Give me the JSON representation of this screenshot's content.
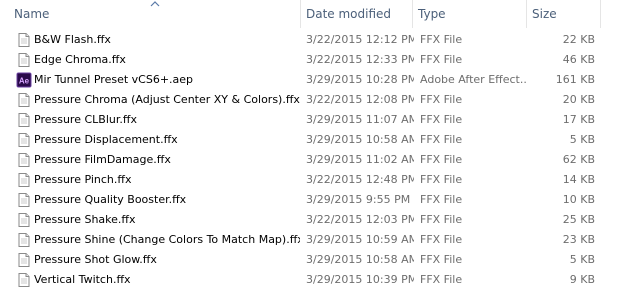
{
  "columns": {
    "name": "Name",
    "date": "Date modified",
    "type": "Type",
    "size": "Size"
  },
  "files": [
    {
      "name": "B&W Flash.ffx",
      "date": "3/22/2015 12:12 PM",
      "type": "FFX File",
      "size": "22 KB",
      "icon": "ffx-file-icon"
    },
    {
      "name": "Edge Chroma.ffx",
      "date": "3/22/2015 12:33 PM",
      "type": "FFX File",
      "size": "46 KB",
      "icon": "ffx-file-icon"
    },
    {
      "name": "Mir Tunnel Preset vCS6+.aep",
      "date": "3/29/2015 10:28 PM",
      "type": "Adobe After Effect...",
      "size": "161 KB",
      "icon": "after-effects-project-icon"
    },
    {
      "name": "Pressure Chroma (Adjust Center XY & Colors).ffx",
      "date": "3/22/2015 12:08 PM",
      "type": "FFX File",
      "size": "20 KB",
      "icon": "ffx-file-icon"
    },
    {
      "name": "Pressure CLBlur.ffx",
      "date": "3/29/2015 11:07 AM",
      "type": "FFX File",
      "size": "17 KB",
      "icon": "ffx-file-icon"
    },
    {
      "name": "Pressure Displacement.ffx",
      "date": "3/29/2015 10:58 AM",
      "type": "FFX File",
      "size": "5 KB",
      "icon": "ffx-file-icon"
    },
    {
      "name": "Pressure FilmDamage.ffx",
      "date": "3/29/2015 11:02 AM",
      "type": "FFX File",
      "size": "62 KB",
      "icon": "ffx-file-icon"
    },
    {
      "name": "Pressure Pinch.ffx",
      "date": "3/22/2015 12:48 PM",
      "type": "FFX File",
      "size": "14 KB",
      "icon": "ffx-file-icon"
    },
    {
      "name": "Pressure Quality Booster.ffx",
      "date": "3/29/2015 9:55 PM",
      "type": "FFX File",
      "size": "10 KB",
      "icon": "ffx-file-icon"
    },
    {
      "name": "Pressure Shake.ffx",
      "date": "3/22/2015 12:03 PM",
      "type": "FFX File",
      "size": "25 KB",
      "icon": "ffx-file-icon"
    },
    {
      "name": "Pressure Shine (Change Colors To Match Map).ffx",
      "date": "3/29/2015 10:59 AM",
      "type": "FFX File",
      "size": "23 KB",
      "icon": "ffx-file-icon"
    },
    {
      "name": "Pressure Shot Glow.ffx",
      "date": "3/29/2015 10:58 AM",
      "type": "FFX File",
      "size": "5 KB",
      "icon": "ffx-file-icon"
    },
    {
      "name": "Vertical Twitch.ffx",
      "date": "3/29/2015 10:39 PM",
      "type": "FFX File",
      "size": "9 KB",
      "icon": "ffx-file-icon"
    }
  ],
  "colors": {
    "header_text": "#4c607a",
    "secondary_text": "#6d6d6d",
    "ae_icon_bg": "#2a0a4a",
    "ae_icon_text": "#d9a6ff"
  }
}
